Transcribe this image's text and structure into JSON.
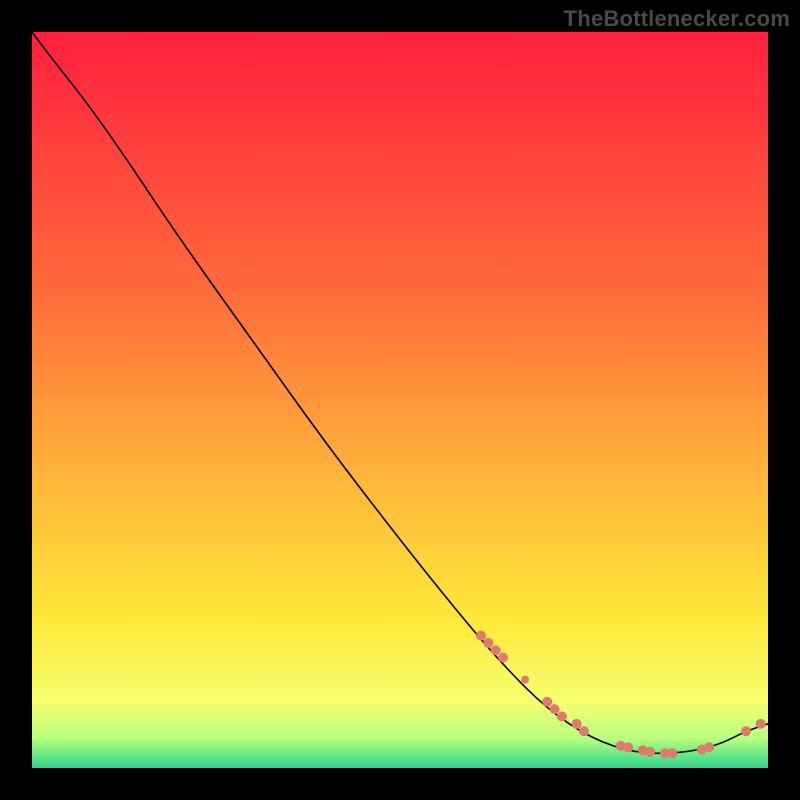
{
  "watermark": "TheBottlenecker.com",
  "gradient_colors": {
    "c0": "#ff1f3f",
    "c1": "#ff6a3a",
    "c2": "#ffb93a",
    "c3": "#ffe93a",
    "c4": "#f7ff70",
    "c5": "#b8ff7e",
    "c6": "#2dd68a"
  },
  "dot_color": "#e0796e",
  "chart_data": {
    "type": "line",
    "title": "",
    "xlabel": "",
    "ylabel": "",
    "xlim": [
      0,
      100
    ],
    "ylim": [
      0,
      100
    ],
    "note": "Axes are unlabeled in the source image; values below are normalized 0–100 estimates read from pixel positions.",
    "series": [
      {
        "name": "curve",
        "kind": "path",
        "points": [
          {
            "x": 0,
            "y": 100
          },
          {
            "x": 3,
            "y": 96
          },
          {
            "x": 7,
            "y": 91
          },
          {
            "x": 12,
            "y": 84
          },
          {
            "x": 20,
            "y": 72
          },
          {
            "x": 30,
            "y": 58
          },
          {
            "x": 40,
            "y": 44
          },
          {
            "x": 50,
            "y": 31
          },
          {
            "x": 58,
            "y": 21
          },
          {
            "x": 64,
            "y": 14
          },
          {
            "x": 70,
            "y": 8
          },
          {
            "x": 76,
            "y": 4
          },
          {
            "x": 82,
            "y": 2
          },
          {
            "x": 88,
            "y": 2
          },
          {
            "x": 93,
            "y": 3
          },
          {
            "x": 97,
            "y": 5
          },
          {
            "x": 100,
            "y": 6
          }
        ]
      },
      {
        "name": "marked-points",
        "kind": "scatter",
        "points": [
          {
            "x": 61,
            "y": 18,
            "r": 5
          },
          {
            "x": 62,
            "y": 17,
            "r": 5
          },
          {
            "x": 63,
            "y": 16,
            "r": 5
          },
          {
            "x": 64,
            "y": 15,
            "r": 5
          },
          {
            "x": 67,
            "y": 12,
            "r": 4
          },
          {
            "x": 70,
            "y": 9,
            "r": 5
          },
          {
            "x": 71,
            "y": 8,
            "r": 5
          },
          {
            "x": 72,
            "y": 7,
            "r": 5
          },
          {
            "x": 74,
            "y": 6,
            "r": 5
          },
          {
            "x": 75,
            "y": 5,
            "r": 5
          },
          {
            "x": 80,
            "y": 3,
            "r": 5
          },
          {
            "x": 81,
            "y": 2.8,
            "r": 5
          },
          {
            "x": 83,
            "y": 2.4,
            "r": 5
          },
          {
            "x": 84,
            "y": 2.2,
            "r": 5
          },
          {
            "x": 86,
            "y": 2,
            "r": 5
          },
          {
            "x": 87,
            "y": 2,
            "r": 5
          },
          {
            "x": 91,
            "y": 2.5,
            "r": 5
          },
          {
            "x": 92,
            "y": 2.8,
            "r": 5
          },
          {
            "x": 97,
            "y": 5,
            "r": 5
          },
          {
            "x": 99,
            "y": 6,
            "r": 5
          }
        ]
      }
    ]
  }
}
